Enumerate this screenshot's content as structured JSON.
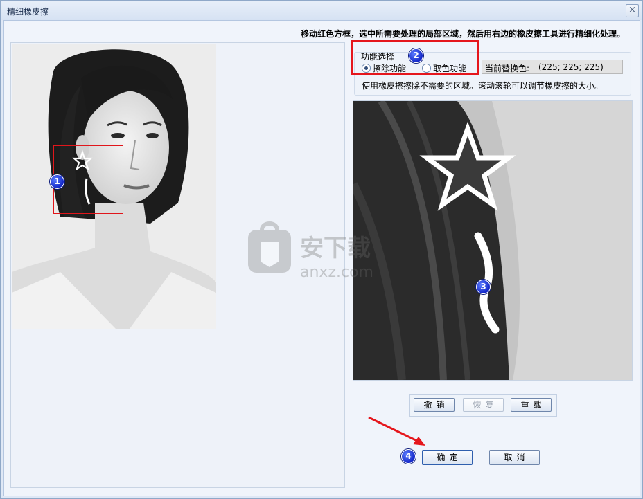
{
  "window": {
    "title": "精细橡皮擦"
  },
  "close_glyph": "×",
  "instruction": "移动红色方框，选中所需要处理的局部区域，然后用右边的橡皮擦工具进行精细化处理。",
  "function_select": {
    "label": "功能选择",
    "options": [
      {
        "label": "擦除功能",
        "checked": true
      },
      {
        "label": "取色功能",
        "checked": false
      }
    ],
    "color_label": "当前替换色:",
    "color_value": "(225; 225; 225)",
    "hint": "使用橡皮擦擦除不需要的区域。滚动滚轮可以调节橡皮擦的大小。"
  },
  "toolbar": {
    "undo": "撤销",
    "redo": "恢复",
    "reset": "重载",
    "redo_disabled": true
  },
  "dialog_buttons": {
    "ok": "确定",
    "cancel": "取消"
  },
  "annotations": {
    "badge1": "1",
    "badge2": "2",
    "badge3": "3",
    "badge4": "4"
  },
  "watermark": {
    "brand": "安下载",
    "domain": "anxz.com"
  },
  "colors": {
    "selection_red": "#e0161b",
    "badge_blue": "#1c33d6",
    "arrow_red": "#e5161c"
  }
}
